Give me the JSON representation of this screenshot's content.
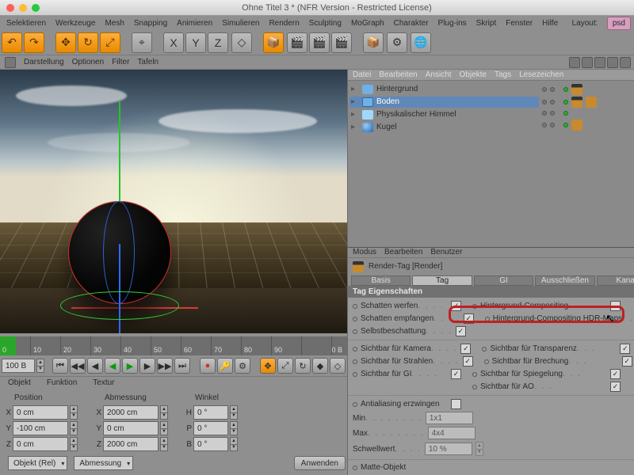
{
  "window": {
    "title": "Ohne Titel 3 * (NFR Version - Restricted License)"
  },
  "menu": [
    "Selektieren",
    "Werkzeuge",
    "Mesh",
    "Snapping",
    "Animieren",
    "Simulieren",
    "Rendern",
    "Sculpting",
    "MoGraph",
    "Charakter",
    "Plug-ins",
    "Skript",
    "Fenster",
    "Hilfe"
  ],
  "layout_label": "Layout:",
  "layout_value": "psd",
  "vptabs": [
    "Darstellung",
    "Optionen",
    "Filter",
    "Tafeln"
  ],
  "objmenu": [
    "Datei",
    "Bearbeiten",
    "Ansicht",
    "Objekte",
    "Tags",
    "Lesezeichen"
  ],
  "attrmenu": [
    "Modus",
    "Bearbeiten",
    "Benutzer"
  ],
  "tree": [
    {
      "name": "Hintergrund",
      "icon": "ic-bg",
      "sel": false,
      "tags": [
        "clap"
      ]
    },
    {
      "name": "Boden",
      "icon": "ic-floor",
      "sel": true,
      "tags": [
        "clap",
        "sphere"
      ]
    },
    {
      "name": "Physikalischer Himmel",
      "icon": "ic-sky",
      "sel": false,
      "tags": []
    },
    {
      "name": "Kugel",
      "icon": "ic-sphere",
      "sel": false,
      "tags": [
        "sphere"
      ]
    }
  ],
  "attr": {
    "head": "Render-Tag [Render]",
    "tabs": [
      "Basis",
      "Tag",
      "GI",
      "Ausschließen",
      "Kanal"
    ],
    "active_tab": "Tag",
    "group": "Tag Eigenschaften",
    "rowsA": [
      {
        "l": "Schatten werfen",
        "c": true,
        "r": "Hintergrund-Compositing",
        "rc": false
      },
      {
        "l": "Schatten empfangen",
        "c": true,
        "r": "Hintergrund-Compositing HDR-Maps",
        "rc": false
      },
      {
        "l": "Selbstbeschattung",
        "c": true
      }
    ],
    "rowsB": [
      {
        "l": "Sichtbar für Kamera",
        "c": true,
        "r": "Sichtbar für Transparenz",
        "rc": true
      },
      {
        "l": "Sichtbar für Strahlen",
        "c": true,
        "r": "Sichtbar für Brechung",
        "rc": true
      },
      {
        "l": "Sichtbar für GI",
        "c": true,
        "r": "Sichtbar für Spiegelung",
        "rc": true
      },
      {
        "l": "",
        "c": null,
        "r": "Sichtbar für AO",
        "rc": true
      }
    ],
    "aa": {
      "label": "Antialiasing erzwingen",
      "c": false,
      "min_l": "Min",
      "min_v": "1x1",
      "max_l": "Max",
      "max_v": "4x4",
      "thr_l": "Schwellwert",
      "thr_v": "10 %"
    },
    "matte": "Matte-Objekt"
  },
  "timeline": {
    "start": "0",
    "end": "100 B",
    "marks": [
      "0",
      "10",
      "20",
      "30",
      "40",
      "50",
      "60",
      "70",
      "80",
      "90",
      "0 B"
    ]
  },
  "transport_field": "100 B",
  "coord_tabs": [
    "Objekt",
    "Funktion",
    "Textur"
  ],
  "coords": {
    "pos_label": "Position",
    "pos": [
      [
        "X",
        "0 cm"
      ],
      [
        "Y",
        "-100 cm"
      ],
      [
        "Z",
        "0 cm"
      ]
    ],
    "dim_label": "Abmessung",
    "dim": [
      [
        "X",
        "2000 cm"
      ],
      [
        "Y",
        "0 cm"
      ],
      [
        "Z",
        "2000 cm"
      ]
    ],
    "ang_label": "Winkel",
    "ang": [
      [
        "H",
        "0 °"
      ],
      [
        "P",
        "0 °"
      ],
      [
        "B",
        "0 °"
      ]
    ]
  },
  "coord_foot": {
    "space": "Objekt (Rel)",
    "dim": "Abmessung",
    "apply": "Anwenden"
  },
  "toolbar_icons": [
    "↶",
    "↷",
    "✥",
    "↻",
    "⤢",
    "⌖",
    "X",
    "Y",
    "Z",
    "◇",
    "📦",
    "🎬",
    "🎬",
    "🎬",
    "",
    "📦",
    "⚙",
    "🌐"
  ]
}
